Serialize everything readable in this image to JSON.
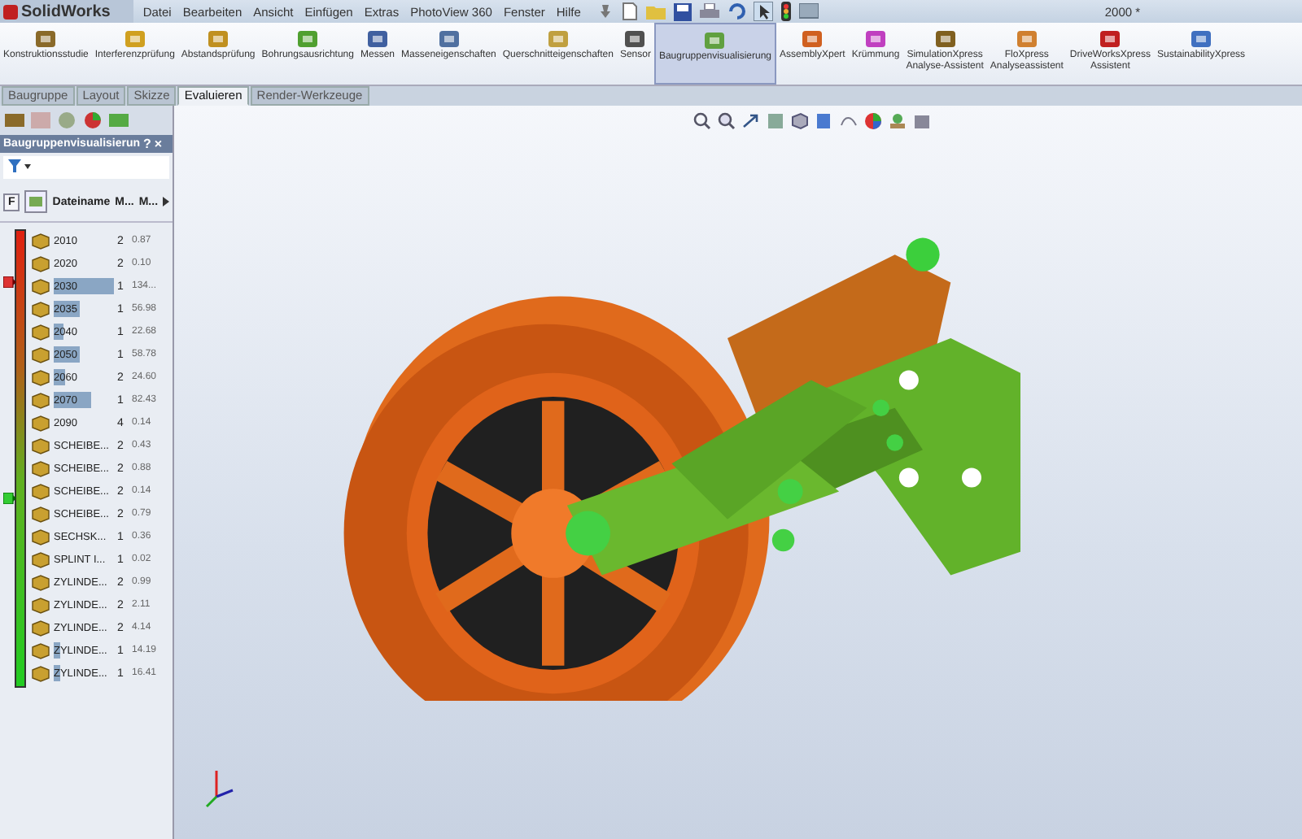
{
  "app": {
    "logo": "SolidWorks",
    "title": "2000 *"
  },
  "menu": [
    "Datei",
    "Bearbeiten",
    "Ansicht",
    "Einfügen",
    "Extras",
    "PhotoView 360",
    "Fenster",
    "Hilfe"
  ],
  "ribbon": [
    {
      "label": "Konstruktionsstudie",
      "selected": false
    },
    {
      "label": "Interferenzprüfung",
      "selected": false
    },
    {
      "label": "Abstandsprüfung",
      "selected": false
    },
    {
      "label": "Bohrungsausrichtung",
      "selected": false
    },
    {
      "label": "Messen",
      "selected": false
    },
    {
      "label": "Masseneigenschaften",
      "selected": false
    },
    {
      "label": "Querschnitteigenschaften",
      "selected": false
    },
    {
      "label": "Sensor",
      "selected": false
    },
    {
      "label": "Baugruppenvisualisierung",
      "selected": true
    },
    {
      "label": "AssemblyXpert",
      "selected": false
    },
    {
      "label": "Krümmung",
      "selected": false
    },
    {
      "label": "SimulationXpress\nAnalyse-Assistent",
      "selected": false
    },
    {
      "label": "FloXpress\nAnalyseassistent",
      "selected": false
    },
    {
      "label": "DriveWorksXpress\nAssistent",
      "selected": false
    },
    {
      "label": "SustainabilityXpress",
      "selected": false
    }
  ],
  "tabs": [
    {
      "label": "Baugruppe",
      "selected": false
    },
    {
      "label": "Layout",
      "selected": false
    },
    {
      "label": "Skizze",
      "selected": false
    },
    {
      "label": "Evaluieren",
      "selected": true
    },
    {
      "label": "Render-Werkzeuge",
      "selected": false
    }
  ],
  "panel": {
    "title": "Baugruppenvisualisierun",
    "help": "?",
    "close": "×",
    "filter_button": "F",
    "columns": [
      "Dateiname",
      "M...",
      "M..."
    ],
    "rows": [
      {
        "name": "2010",
        "count": "2",
        "value": "0.87"
      },
      {
        "name": "2020",
        "count": "2",
        "value": "0.10"
      },
      {
        "name": "2030",
        "count": "1",
        "value": "134...",
        "level": 1.0
      },
      {
        "name": "2035",
        "count": "1",
        "value": "56.98",
        "level": 0.42
      },
      {
        "name": "2040",
        "count": "1",
        "value": "22.68",
        "level": 0.17
      },
      {
        "name": "2050",
        "count": "1",
        "value": "58.78",
        "level": 0.44
      },
      {
        "name": "2060",
        "count": "2",
        "value": "24.60",
        "level": 0.18
      },
      {
        "name": "2070",
        "count": "1",
        "value": "82.43",
        "level": 0.62
      },
      {
        "name": "2090",
        "count": "4",
        "value": "0.14"
      },
      {
        "name": "SCHEIBE...",
        "count": "2",
        "value": "0.43"
      },
      {
        "name": "SCHEIBE...",
        "count": "2",
        "value": "0.88"
      },
      {
        "name": "SCHEIBE...",
        "count": "2",
        "value": "0.14"
      },
      {
        "name": "SCHEIBE...",
        "count": "2",
        "value": "0.79"
      },
      {
        "name": "SECHSK...",
        "count": "1",
        "value": "0.36"
      },
      {
        "name": "SPLINT I...",
        "count": "1",
        "value": "0.02"
      },
      {
        "name": "ZYLINDE...",
        "count": "2",
        "value": "0.99"
      },
      {
        "name": "ZYLINDE...",
        "count": "2",
        "value": "2.11"
      },
      {
        "name": "ZYLINDE...",
        "count": "2",
        "value": "4.14"
      },
      {
        "name": "ZYLINDE...",
        "count": "1",
        "value": "14.19",
        "level": 0.1
      },
      {
        "name": "ZYLINDE...",
        "count": "1",
        "value": "16.41",
        "level": 0.12
      }
    ]
  }
}
